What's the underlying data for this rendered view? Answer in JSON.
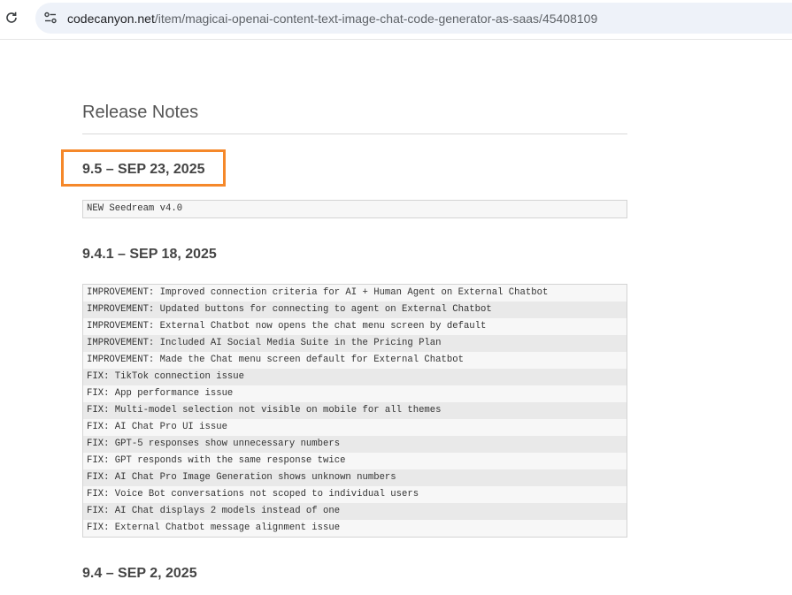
{
  "browser": {
    "url_domain": "codecanyon.net",
    "url_path": "/item/magicai-openai-content-text-image-chat-code-generator-as-saas/45408109"
  },
  "page": {
    "section_title": "Release Notes",
    "releases": [
      {
        "version": "9.5 – SEP 23, 2025",
        "notes": [
          "NEW Seedream v4.0"
        ]
      },
      {
        "version": "9.4.1 – SEP 18, 2025",
        "notes": [
          "IMPROVEMENT: Improved connection criteria for AI + Human Agent on External Chatbot",
          "IMPROVEMENT: Updated buttons for connecting to agent on External Chatbot",
          "IMPROVEMENT: External Chatbot now opens the chat menu screen by default",
          "IMPROVEMENT: Included AI Social Media Suite in the Pricing Plan",
          "IMPROVEMENT: Made the Chat menu screen default for External Chatbot",
          "FIX: TikTok connection issue",
          "FIX: App performance issue",
          "FIX: Multi-model selection not visible on mobile for all themes",
          "FIX: AI Chat Pro UI issue",
          "FIX: GPT-5 responses show unnecessary numbers",
          "FIX: GPT responds with the same response twice",
          "FIX: AI Chat Pro Image Generation shows unknown numbers",
          "FIX: Voice Bot conversations not scoped to individual users",
          "FIX: AI Chat displays 2 models instead of one",
          "FIX: External Chatbot message alignment issue"
        ]
      },
      {
        "version": "9.4 – SEP 2, 2025",
        "notes": []
      }
    ]
  },
  "colors": {
    "highlight_border": "#f5882a",
    "omnibox_bg": "#eef2f9"
  },
  "icons": [
    "reload-icon",
    "site-info-icon"
  ]
}
